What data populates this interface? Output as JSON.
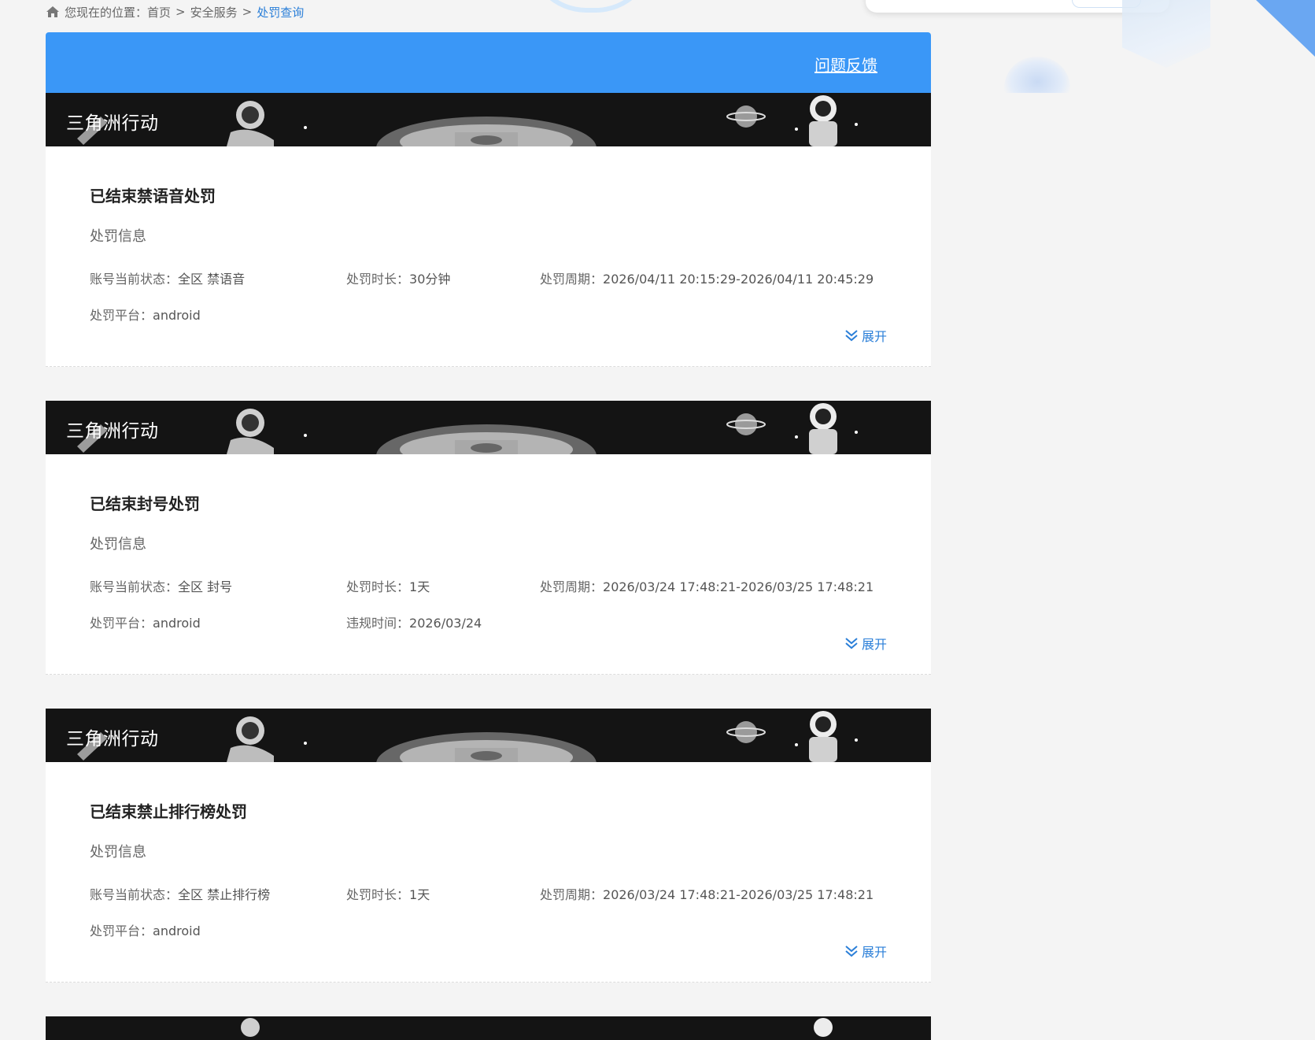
{
  "breadcrumb": {
    "prefix": "您现在的位置：",
    "items": [
      "首页",
      "安全服务"
    ],
    "current": "处罚查询",
    "separator": ">"
  },
  "header": {
    "feedback_label": "问题反馈"
  },
  "cards": [
    {
      "game": "三角洲行动",
      "title": "已结束禁语音处罚",
      "section": "处罚信息",
      "status_label": "账号当前状态：",
      "status": "全区 禁语音",
      "duration_label": "处罚时长：",
      "duration": "30分钟",
      "period_label": "处罚周期：",
      "period": "2026/04/11 20:15:29-2026/04/11 20:45:29",
      "platform_label": "处罚平台：",
      "platform": "android",
      "violation_label": "",
      "violation": "",
      "expand_label": "展开"
    },
    {
      "game": "三角洲行动",
      "title": "已结束封号处罚",
      "section": "处罚信息",
      "status_label": "账号当前状态：",
      "status": "全区 封号",
      "duration_label": "处罚时长：",
      "duration": "1天",
      "period_label": "处罚周期：",
      "period": "2026/03/24 17:48:21-2026/03/25 17:48:21",
      "platform_label": "处罚平台：",
      "platform": "android",
      "violation_label": "违规时间：",
      "violation": "2026/03/24",
      "expand_label": "展开"
    },
    {
      "game": "三角洲行动",
      "title": "已结束禁止排行榜处罚",
      "section": "处罚信息",
      "status_label": "账号当前状态：",
      "status": "全区 禁止排行榜",
      "duration_label": "处罚时长：",
      "duration": "1天",
      "period_label": "处罚周期：",
      "period": "2026/03/24 17:48:21-2026/03/25 17:48:21",
      "platform_label": "处罚平台：",
      "platform": "android",
      "violation_label": "",
      "violation": "",
      "expand_label": "展开"
    }
  ],
  "colors": {
    "accent": "#3a97f7",
    "link": "#2b7fd8",
    "banner_bg": "#141414",
    "page_bg": "#f4f4f4"
  },
  "icons": [
    "home-icon",
    "chevron-double-down-icon"
  ]
}
